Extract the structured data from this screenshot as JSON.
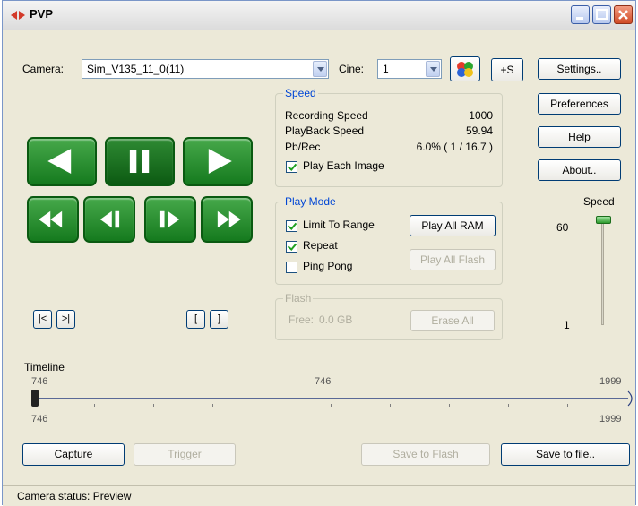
{
  "window": {
    "title": "PVP"
  },
  "camera": {
    "label": "Camera:",
    "value": "Sim_V135_11_0(11)"
  },
  "cine": {
    "label": "Cine:",
    "value": "1"
  },
  "plus_s_label": "+S",
  "side_buttons": {
    "settings": "Settings..",
    "preferences": "Preferences",
    "help": "Help",
    "about": "About.."
  },
  "speed_group": {
    "title": "Speed",
    "recording_label": "Recording Speed",
    "recording_value": "1000",
    "playback_label": "PlayBack Speed",
    "playback_value": "59.94",
    "pbrec_label": "Pb/Rec",
    "pbrec_value": "6.0% ( 1 / 16.7 )",
    "play_each_label": "Play Each Image",
    "play_each_checked": true
  },
  "play_mode": {
    "title": "Play Mode",
    "limit_label": "Limit To Range",
    "limit_checked": true,
    "repeat_label": "Repeat",
    "repeat_checked": true,
    "pingpong_label": "Ping Pong",
    "pingpong_checked": false,
    "play_all_ram": "Play All RAM",
    "play_all_flash": "Play All Flash"
  },
  "flash": {
    "title": "Flash",
    "free_label": "Free:",
    "free_value": "0.0 GB",
    "erase_label": "Erase All"
  },
  "speed_slider": {
    "label": "Speed",
    "max": "60",
    "min": "1",
    "level": 1.0
  },
  "nav_buttons": {
    "first": "|<",
    "last": ">|",
    "mark_in": "[",
    "mark_out": "]"
  },
  "timeline": {
    "label": "Timeline",
    "start_top": "746",
    "current": "746",
    "end_top": "1999",
    "start_bottom": "746",
    "end_bottom": "1999",
    "position": 0.0
  },
  "bottom": {
    "capture": "Capture",
    "trigger": "Trigger",
    "save_flash": "Save to Flash",
    "save_file": "Save to file.."
  },
  "status": "Camera status: Preview",
  "colors": {
    "accent_green": "#1d8a26",
    "group_title_blue": "#0046d5"
  }
}
